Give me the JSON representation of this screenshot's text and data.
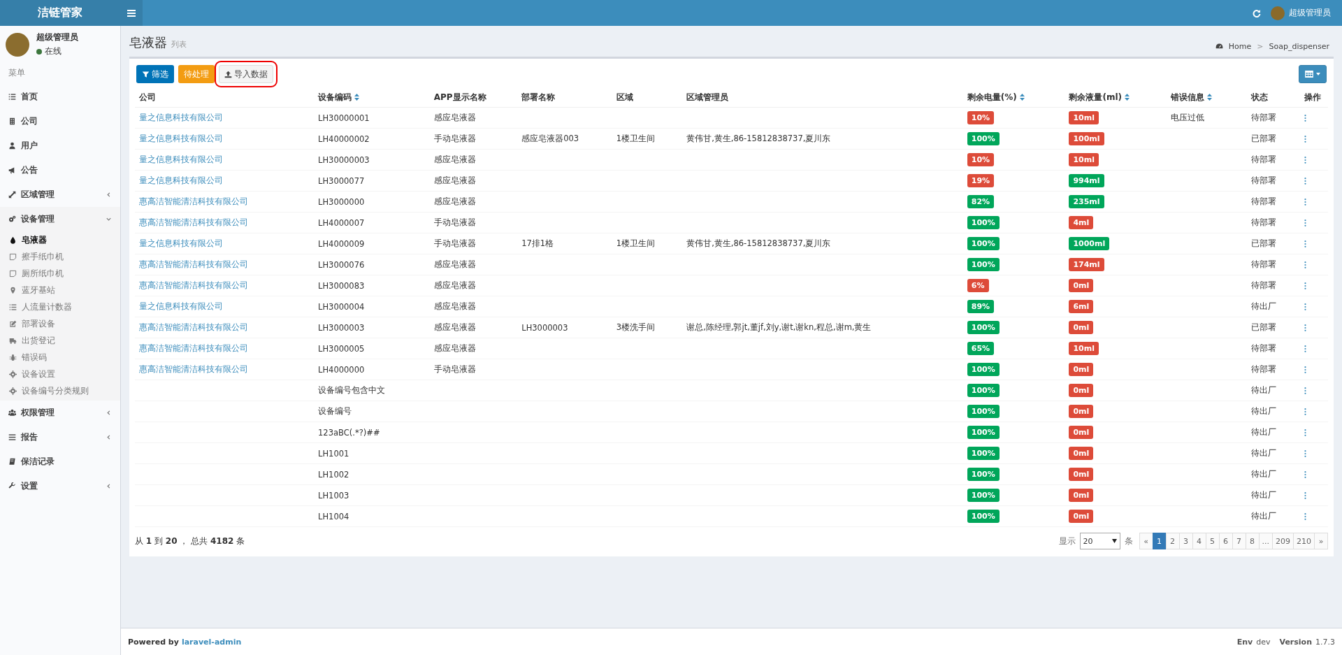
{
  "brand": "洁链管家",
  "topbar": {
    "user": "超级管理员"
  },
  "sidebar": {
    "user": {
      "name": "超级管理员",
      "status": "在线",
      "online": true
    },
    "menu_header": "菜单",
    "items": [
      {
        "label": "首页"
      },
      {
        "label": "公司"
      },
      {
        "label": "用户"
      },
      {
        "label": "公告"
      },
      {
        "label": "区域管理",
        "expanded": false
      },
      {
        "label": "设备管理",
        "expanded": true,
        "children": [
          {
            "label": "皂液器",
            "selected": true
          },
          {
            "label": "擦手纸巾机",
            "selected": false
          },
          {
            "label": "厕所纸巾机",
            "selected": false
          },
          {
            "label": "蓝牙基站",
            "selected": false
          },
          {
            "label": "人流量计数器",
            "selected": false
          },
          {
            "label": "部署设备",
            "selected": false
          },
          {
            "label": "出货登记",
            "selected": false
          },
          {
            "label": "错误码",
            "selected": false
          },
          {
            "label": "设备设置",
            "selected": false
          },
          {
            "label": "设备编号分类规则",
            "selected": false
          }
        ]
      },
      {
        "label": "权限管理",
        "expanded": false
      },
      {
        "label": "报告",
        "expanded": false
      },
      {
        "label": "保洁记录"
      },
      {
        "label": "设置",
        "expanded": false
      }
    ]
  },
  "page": {
    "title": "皂液器",
    "subtitle": "列表",
    "breadcrumb": [
      "Home",
      "Soap_dispenser"
    ],
    "breadcrumb_separator": ">"
  },
  "toolbar": {
    "buttons": [
      {
        "label": "筛选",
        "kind": "filter",
        "highlighted": false
      },
      {
        "label": "待处理",
        "kind": "warning",
        "highlighted": false
      },
      {
        "label": "导入数据",
        "kind": "upload",
        "highlighted": true
      }
    ]
  },
  "table": {
    "columns": [
      {
        "label": "公司",
        "sortable": false
      },
      {
        "label": "设备编码",
        "sortable": true
      },
      {
        "label": "APP显示名称",
        "sortable": false
      },
      {
        "label": "部署名称",
        "sortable": false
      },
      {
        "label": "区域",
        "sortable": false
      },
      {
        "label": "区域管理员",
        "sortable": false
      },
      {
        "label": "剩余电量(%)",
        "sortable": true
      },
      {
        "label": "剩余液量(ml)",
        "sortable": true
      },
      {
        "label": "错误信息",
        "sortable": true
      },
      {
        "label": "状态",
        "sortable": false
      },
      {
        "label": "操作",
        "sortable": false
      }
    ],
    "rows": [
      {
        "company": "量之信息科技有限公司",
        "code": "LH30000001",
        "app_name": "感应皂液器",
        "battery": {
          "text": "10%",
          "color": "#dd4b39"
        },
        "liquid": {
          "text": "10ml",
          "color": "#dd4b39"
        },
        "error": "电压过低",
        "status": "待部署"
      },
      {
        "company": "量之信息科技有限公司",
        "code": "LH40000002",
        "app_name": "手动皂液器",
        "deploy_name": "感应皂液器003",
        "area": "1楼卫生间",
        "managers": "黄伟甘,黄生,86-15812838737,夏川东",
        "battery": {
          "text": "100%",
          "color": "#00a65a"
        },
        "liquid": {
          "text": "100ml",
          "color": "#dd4b39"
        },
        "status": "已部署"
      },
      {
        "company": "量之信息科技有限公司",
        "code": "LH30000003",
        "app_name": "感应皂液器",
        "battery": {
          "text": "10%",
          "color": "#dd4b39"
        },
        "liquid": {
          "text": "10ml",
          "color": "#dd4b39"
        },
        "status": "待部署"
      },
      {
        "company": "量之信息科技有限公司",
        "code": "LH3000077",
        "app_name": "感应皂液器",
        "battery": {
          "text": "19%",
          "color": "#dd4b39"
        },
        "liquid": {
          "text": "994ml",
          "color": "#00a65a"
        },
        "status": "待部署"
      },
      {
        "company": "惠高洁智能清洁科技有限公司",
        "code": "LH3000000",
        "app_name": "感应皂液器",
        "battery": {
          "text": "82%",
          "color": "#00a65a"
        },
        "liquid": {
          "text": "235ml",
          "color": "#00a65a"
        },
        "status": "待部署"
      },
      {
        "company": "惠高洁智能清洁科技有限公司",
        "code": "LH4000007",
        "app_name": "手动皂液器",
        "battery": {
          "text": "100%",
          "color": "#00a65a"
        },
        "liquid": {
          "text": "4ml",
          "color": "#dd4b39"
        },
        "status": "待部署"
      },
      {
        "company": "量之信息科技有限公司",
        "code": "LH4000009",
        "app_name": "手动皂液器",
        "deploy_name": "17排1格",
        "area": "1楼卫生间",
        "managers": "黄伟甘,黄生,86-15812838737,夏川东",
        "battery": {
          "text": "100%",
          "color": "#00a65a"
        },
        "liquid": {
          "text": "1000ml",
          "color": "#00a65a"
        },
        "status": "已部署"
      },
      {
        "company": "惠高洁智能清洁科技有限公司",
        "code": "LH3000076",
        "app_name": "感应皂液器",
        "battery": {
          "text": "100%",
          "color": "#00a65a"
        },
        "liquid": {
          "text": "174ml",
          "color": "#dd4b39"
        },
        "status": "待部署"
      },
      {
        "company": "惠高洁智能清洁科技有限公司",
        "code": "LH3000083",
        "app_name": "感应皂液器",
        "battery": {
          "text": "6%",
          "color": "#dd4b39"
        },
        "liquid": {
          "text": "0ml",
          "color": "#dd4b39"
        },
        "status": "待部署"
      },
      {
        "company": "量之信息科技有限公司",
        "code": "LH3000004",
        "app_name": "感应皂液器",
        "battery": {
          "text": "89%",
          "color": "#00a65a"
        },
        "liquid": {
          "text": "6ml",
          "color": "#dd4b39"
        },
        "status": "待出厂"
      },
      {
        "company": "惠高洁智能清洁科技有限公司",
        "code": "LH3000003",
        "app_name": "感应皂液器",
        "deploy_name": "LH3000003",
        "area": "3楼洗手间",
        "managers": "谢总,陈经理,郭jt,董jf,刘y,谢t,谢kn,程总,谢m,黄生",
        "battery": {
          "text": "100%",
          "color": "#00a65a"
        },
        "liquid": {
          "text": "0ml",
          "color": "#dd4b39"
        },
        "status": "已部署"
      },
      {
        "company": "惠高洁智能清洁科技有限公司",
        "code": "LH3000005",
        "app_name": "感应皂液器",
        "battery": {
          "text": "65%",
          "color": "#00a65a"
        },
        "liquid": {
          "text": "10ml",
          "color": "#dd4b39"
        },
        "status": "待部署"
      },
      {
        "company": "惠高洁智能清洁科技有限公司",
        "code": "LH4000000",
        "app_name": "手动皂液器",
        "battery": {
          "text": "100%",
          "color": "#00a65a"
        },
        "liquid": {
          "text": "0ml",
          "color": "#dd4b39"
        },
        "status": "待部署"
      },
      {
        "code": "设备编号包含中文",
        "battery": {
          "text": "100%",
          "color": "#00a65a"
        },
        "liquid": {
          "text": "0ml",
          "color": "#dd4b39"
        },
        "status": "待出厂"
      },
      {
        "code": "设备编号",
        "battery": {
          "text": "100%",
          "color": "#00a65a"
        },
        "liquid": {
          "text": "0ml",
          "color": "#dd4b39"
        },
        "status": "待出厂"
      },
      {
        "code": "123aBC(.*?)##",
        "battery": {
          "text": "100%",
          "color": "#00a65a"
        },
        "liquid": {
          "text": "0ml",
          "color": "#dd4b39"
        },
        "status": "待出厂"
      },
      {
        "code": "LH1001",
        "battery": {
          "text": "100%",
          "color": "#00a65a"
        },
        "liquid": {
          "text": "0ml",
          "color": "#dd4b39"
        },
        "status": "待出厂"
      },
      {
        "code": "LH1002",
        "battery": {
          "text": "100%",
          "color": "#00a65a"
        },
        "liquid": {
          "text": "0ml",
          "color": "#dd4b39"
        },
        "status": "待出厂"
      },
      {
        "code": "LH1003",
        "battery": {
          "text": "100%",
          "color": "#00a65a"
        },
        "liquid": {
          "text": "0ml",
          "color": "#dd4b39"
        },
        "status": "待出厂"
      },
      {
        "code": "LH1004",
        "battery": {
          "text": "100%",
          "color": "#00a65a"
        },
        "liquid": {
          "text": "0ml",
          "color": "#dd4b39"
        },
        "status": "待出厂"
      }
    ]
  },
  "pagination": {
    "summary": "从 **1** 到 **20** ， 总共 **4182** 条",
    "show_label": "显示",
    "per_page": "20",
    "per_page_unit": "条",
    "pages": [
      {
        "label": "«",
        "selected": false
      },
      {
        "label": "1",
        "selected": true
      },
      {
        "label": "2",
        "selected": false
      },
      {
        "label": "3",
        "selected": false
      },
      {
        "label": "4",
        "selected": false
      },
      {
        "label": "5",
        "selected": false
      },
      {
        "label": "6",
        "selected": false
      },
      {
        "label": "7",
        "selected": false
      },
      {
        "label": "8",
        "selected": false
      },
      {
        "label": "...",
        "selected": false
      },
      {
        "label": "209",
        "selected": false
      },
      {
        "label": "210",
        "selected": false
      },
      {
        "label": "»",
        "selected": false
      }
    ]
  },
  "footer": {
    "powered_label": "Powered by",
    "powered_link": "laravel-admin",
    "env_label": "Env",
    "env": "dev",
    "version_label": "Version",
    "version": "1.7.3"
  }
}
